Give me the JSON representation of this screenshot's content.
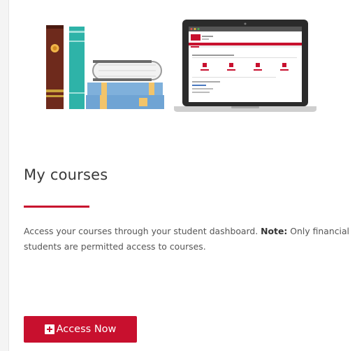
{
  "card": {
    "title": "My courses",
    "description_main": "Access your courses through your student dashboard.",
    "note_label": "Note:",
    "note_text": "Only financial students are permitted access to courses.",
    "button_label": "Access Now"
  },
  "colors": {
    "accent": "#c8102e",
    "title_text": "#3a3a3a",
    "body_text": "#555555"
  },
  "icons": {
    "illustration": "books-and-laptop-illustration",
    "button_icon": "plus-square-icon"
  }
}
